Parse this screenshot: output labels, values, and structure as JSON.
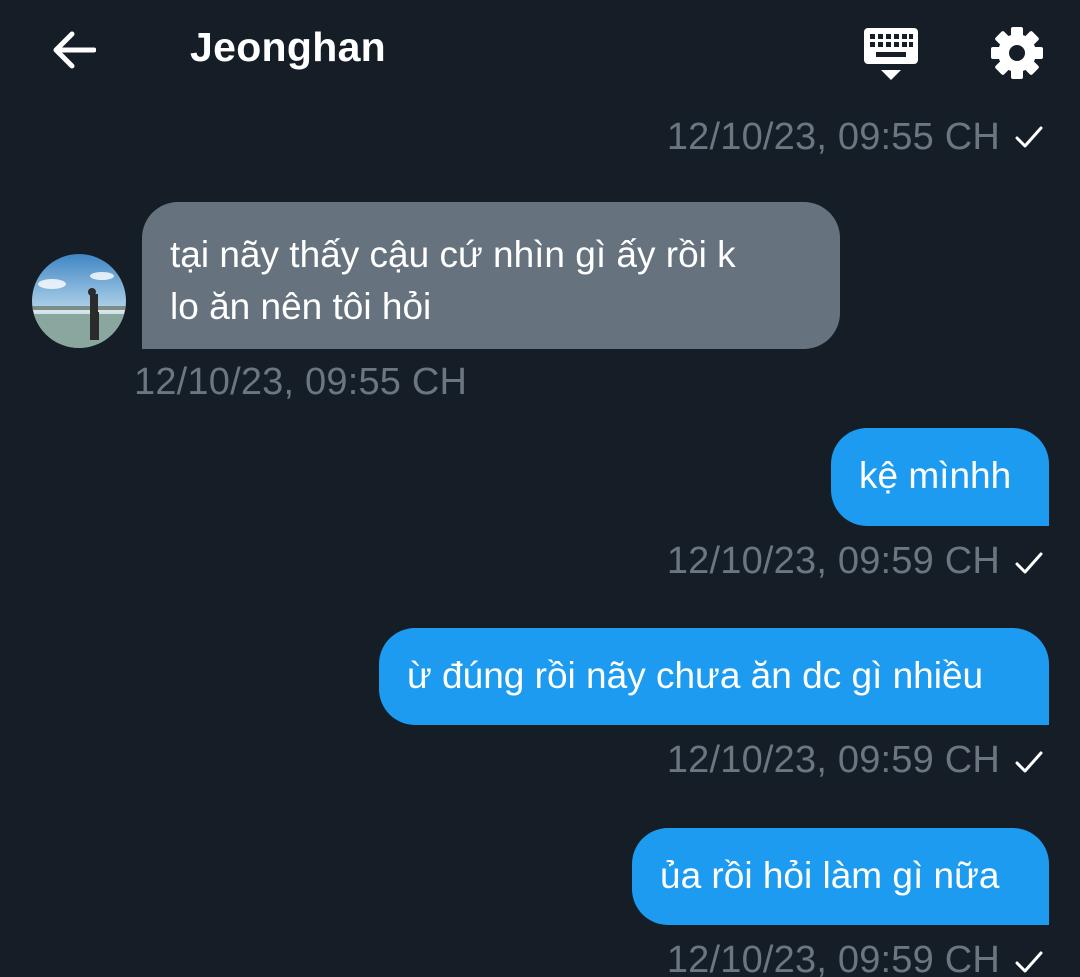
{
  "header": {
    "title": "Jeonghan",
    "back_icon": "arrow-left-icon",
    "keyboard_icon": "keyboard-icon",
    "settings_icon": "gear-icon"
  },
  "colors": {
    "background": "#151d26",
    "incoming_bubble": "#66727e",
    "outgoing_bubble": "#1c9bf0",
    "timestamp": "#6b7681"
  },
  "messages": [
    {
      "direction": "outgoing",
      "text": "",
      "timestamp": "12/10/23, 09:55 CH",
      "status_icon": "check-icon"
    },
    {
      "direction": "incoming",
      "lines": [
        "tại nãy thấy cậu cứ nhìn gì ấy rồi k",
        "lo ăn nên tôi hỏi"
      ],
      "timestamp": "12/10/23, 09:55 CH",
      "avatar": "avatar-photo"
    },
    {
      "direction": "outgoing",
      "text": "kệ mìnhh",
      "timestamp": "12/10/23, 09:59 CH",
      "status_icon": "check-icon"
    },
    {
      "direction": "outgoing",
      "text": "ừ đúng rồi nãy chưa ăn dc gì nhiều",
      "timestamp": "12/10/23, 09:59 CH",
      "status_icon": "check-icon"
    },
    {
      "direction": "outgoing",
      "text": "ủa rồi hỏi làm gì nữa",
      "timestamp": "12/10/23, 09:59 CH",
      "status_icon": "check-icon"
    }
  ]
}
